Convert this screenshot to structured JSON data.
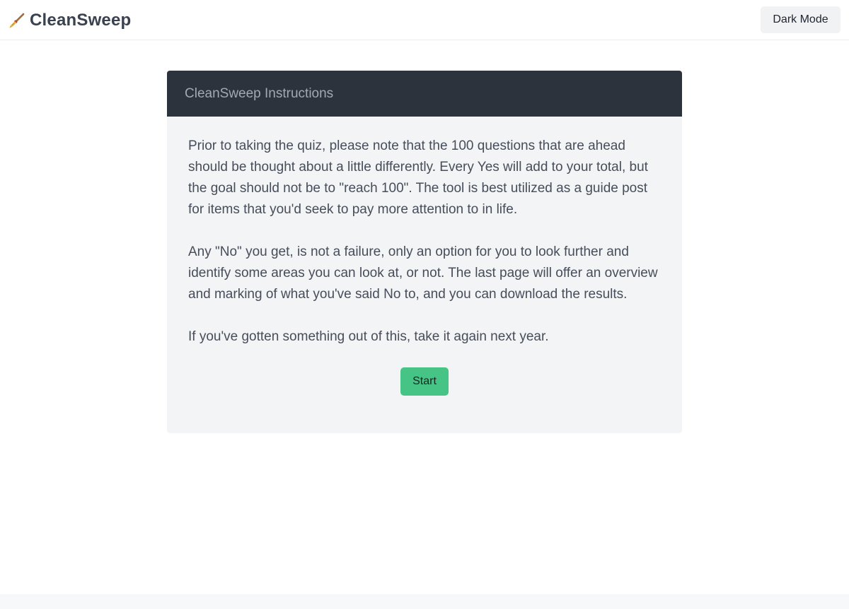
{
  "header": {
    "brand_icon": "broom-icon",
    "brand_name": "CleanSweep",
    "dark_mode_label": "Dark Mode"
  },
  "instructions": {
    "title": "CleanSweep Instructions",
    "paragraphs": [
      "Prior to taking the quiz, please note that the 100 questions that are ahead should be thought about a little differently. Every Yes will add to your total, but the goal should not be to \"reach 100\". The tool is best utilized as a guide post for items that you'd seek to pay more attention to in life.",
      "Any \"No\" you get, is not a failure, only an option for you to look further and identify some areas you can look at, or not. The last page will offer an overview and marking of what you've said No to, and you can download the results.",
      "If you've gotten something out of this, take it again next year."
    ],
    "start_label": "Start"
  },
  "colors": {
    "header_bg": "#2d333c",
    "card_bg": "#f2f4f6",
    "start_button": "#45c486",
    "text": "#474d59"
  }
}
